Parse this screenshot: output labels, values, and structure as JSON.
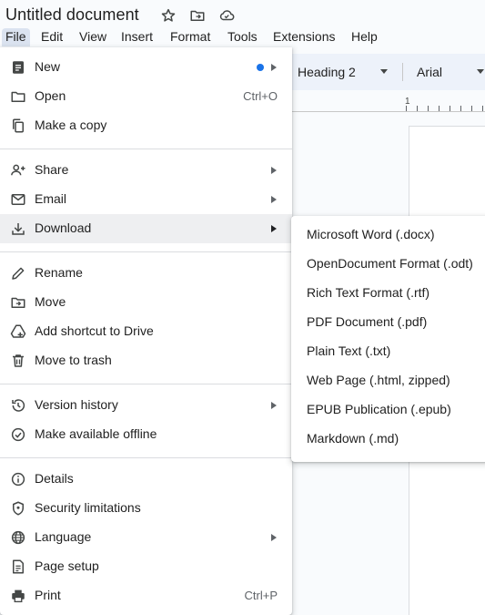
{
  "document": {
    "title": "Untitled document"
  },
  "title_icons": [
    "star-icon",
    "move-to-folder-icon",
    "cloud-status-icon"
  ],
  "menubar": [
    "File",
    "Edit",
    "View",
    "Insert",
    "Format",
    "Tools",
    "Extensions",
    "Help"
  ],
  "toolbar": {
    "style": "Heading 2",
    "font": "Arial"
  },
  "ruler": {
    "number": "1"
  },
  "file_menu": {
    "groups": [
      [
        {
          "label": "New",
          "icon": "document-icon",
          "submenu": true,
          "dot": true
        },
        {
          "label": "Open",
          "icon": "folder-open-icon",
          "shortcut": "Ctrl+O"
        },
        {
          "label": "Make a copy",
          "icon": "copy-icon"
        }
      ],
      [
        {
          "label": "Share",
          "icon": "add-person-icon",
          "submenu": true
        },
        {
          "label": "Email",
          "icon": "mail-icon",
          "submenu": true
        },
        {
          "label": "Download",
          "icon": "download-icon",
          "submenu": true,
          "highlighted": true
        }
      ],
      [
        {
          "label": "Rename",
          "icon": "pencil-icon"
        },
        {
          "label": "Move",
          "icon": "move-folder-icon"
        },
        {
          "label": "Add shortcut to Drive",
          "icon": "drive-shortcut-icon"
        },
        {
          "label": "Move to trash",
          "icon": "trash-icon"
        }
      ],
      [
        {
          "label": "Version history",
          "icon": "history-icon",
          "submenu": true
        },
        {
          "label": "Make available offline",
          "icon": "offline-check-icon"
        }
      ],
      [
        {
          "label": "Details",
          "icon": "info-icon"
        },
        {
          "label": "Security limitations",
          "icon": "shield-icon"
        },
        {
          "label": "Language",
          "icon": "globe-icon",
          "submenu": true
        },
        {
          "label": "Page setup",
          "icon": "page-setup-icon"
        },
        {
          "label": "Print",
          "icon": "printer-icon",
          "shortcut": "Ctrl+P"
        }
      ]
    ]
  },
  "download_submenu": [
    "Microsoft Word (.docx)",
    "OpenDocument Format (.odt)",
    "Rich Text Format (.rtf)",
    "PDF Document (.pdf)",
    "Plain Text (.txt)",
    "Web Page (.html, zipped)",
    "EPUB Publication (.epub)",
    "Markdown (.md)"
  ],
  "colors": {
    "accent_dot": "#1a73e8",
    "menu_highlight": "#eeeff1",
    "active_menu_tab": "#dbe3f0",
    "toolbar_bg": "#edf2fa"
  }
}
